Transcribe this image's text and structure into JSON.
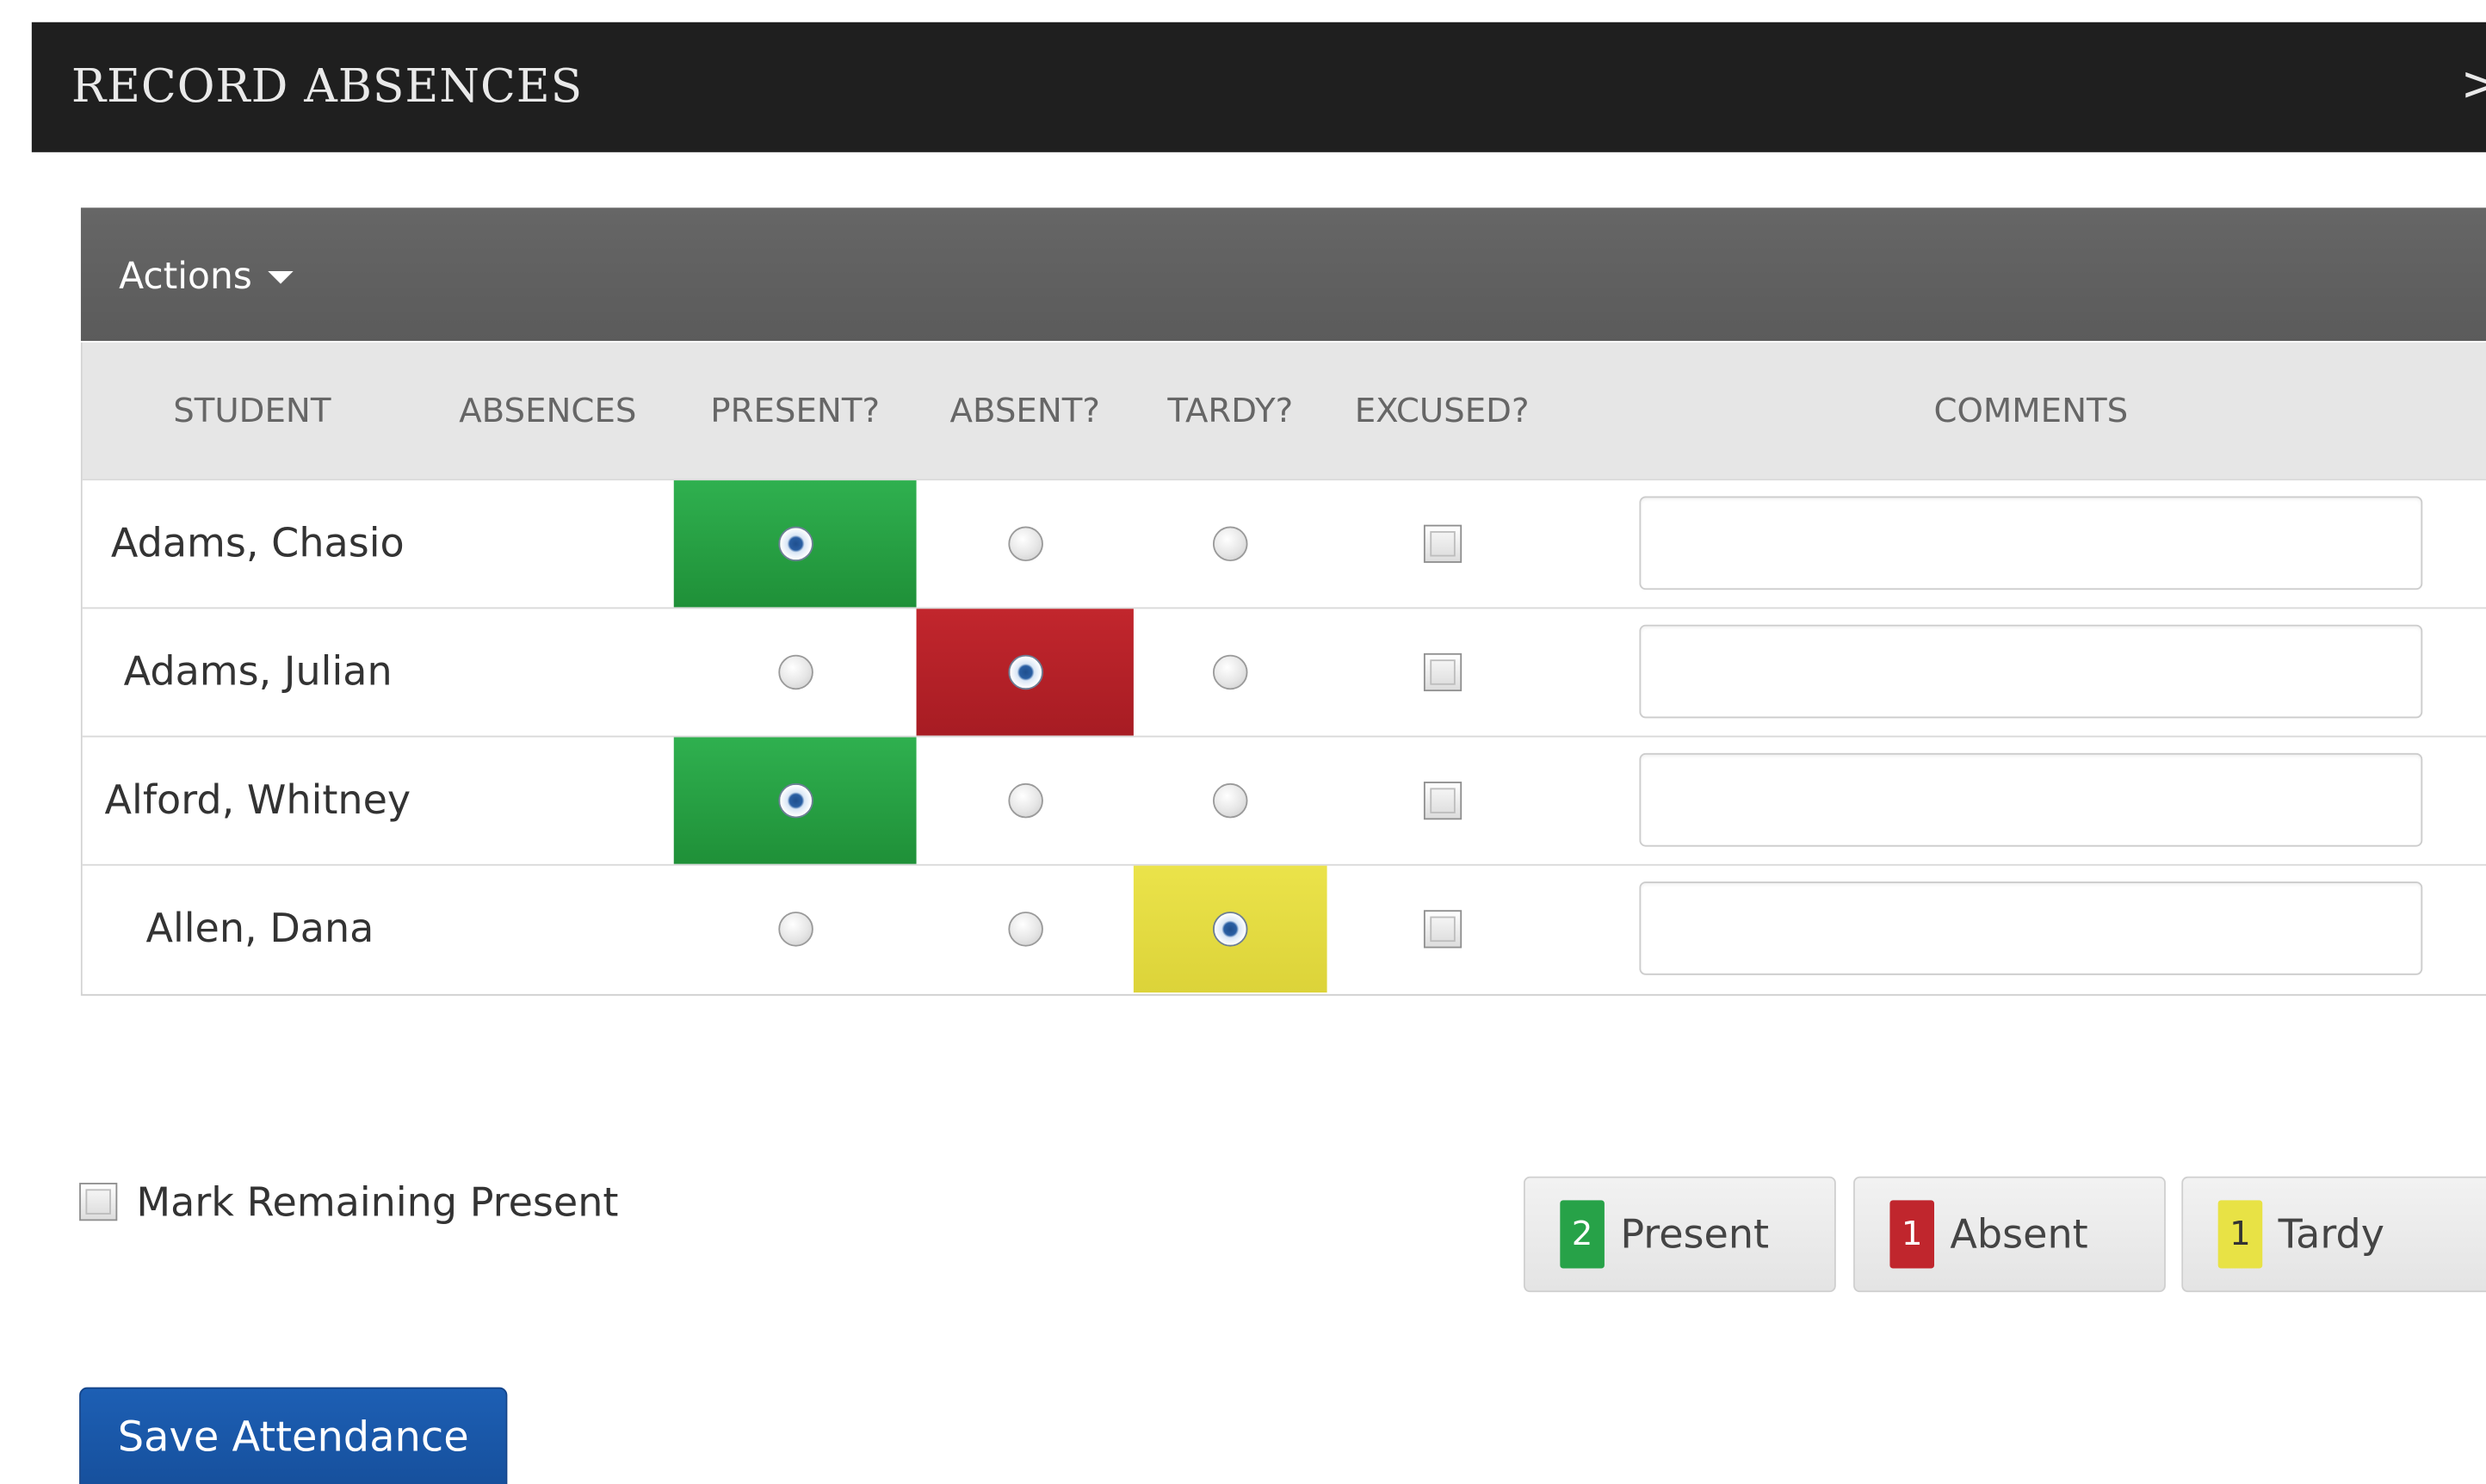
{
  "dialog": {
    "title": "RECORD ABSENCES",
    "close_glyph": ">"
  },
  "toolbar": {
    "actions_label": "Actions"
  },
  "table": {
    "headers": {
      "student": "STUDENT",
      "absences": "ABSENCES",
      "present": "PRESENT?",
      "absent": "ABSENT?",
      "tardy": "TARDY?",
      "excused": "EXCUSED?",
      "comments": "COMMENTS"
    },
    "rows": [
      {
        "student": "Adams, Chasio",
        "status": "present",
        "excused": false,
        "comment": ""
      },
      {
        "student": "Adams, Julian",
        "status": "absent",
        "excused": false,
        "comment": ""
      },
      {
        "student": "Alford, Whitney",
        "status": "present",
        "excused": false,
        "comment": ""
      },
      {
        "student": "Allen, Dana",
        "status": "tardy",
        "excused": false,
        "comment": ""
      }
    ]
  },
  "mark_remaining": {
    "label": "Mark Remaining Present",
    "checked": false
  },
  "summary": {
    "present": {
      "count": "2",
      "label": "Present"
    },
    "absent": {
      "count": "1",
      "label": "Absent"
    },
    "tardy": {
      "count": "1",
      "label": "Tardy"
    }
  },
  "save_button": {
    "label": "Save Attendance"
  },
  "colors": {
    "present": "#27a248",
    "absent": "#c0262d",
    "tardy": "#e8e245",
    "primary": "#1d5fb4",
    "title_bar": "#1f1f1f",
    "toolbar": "#606060"
  }
}
